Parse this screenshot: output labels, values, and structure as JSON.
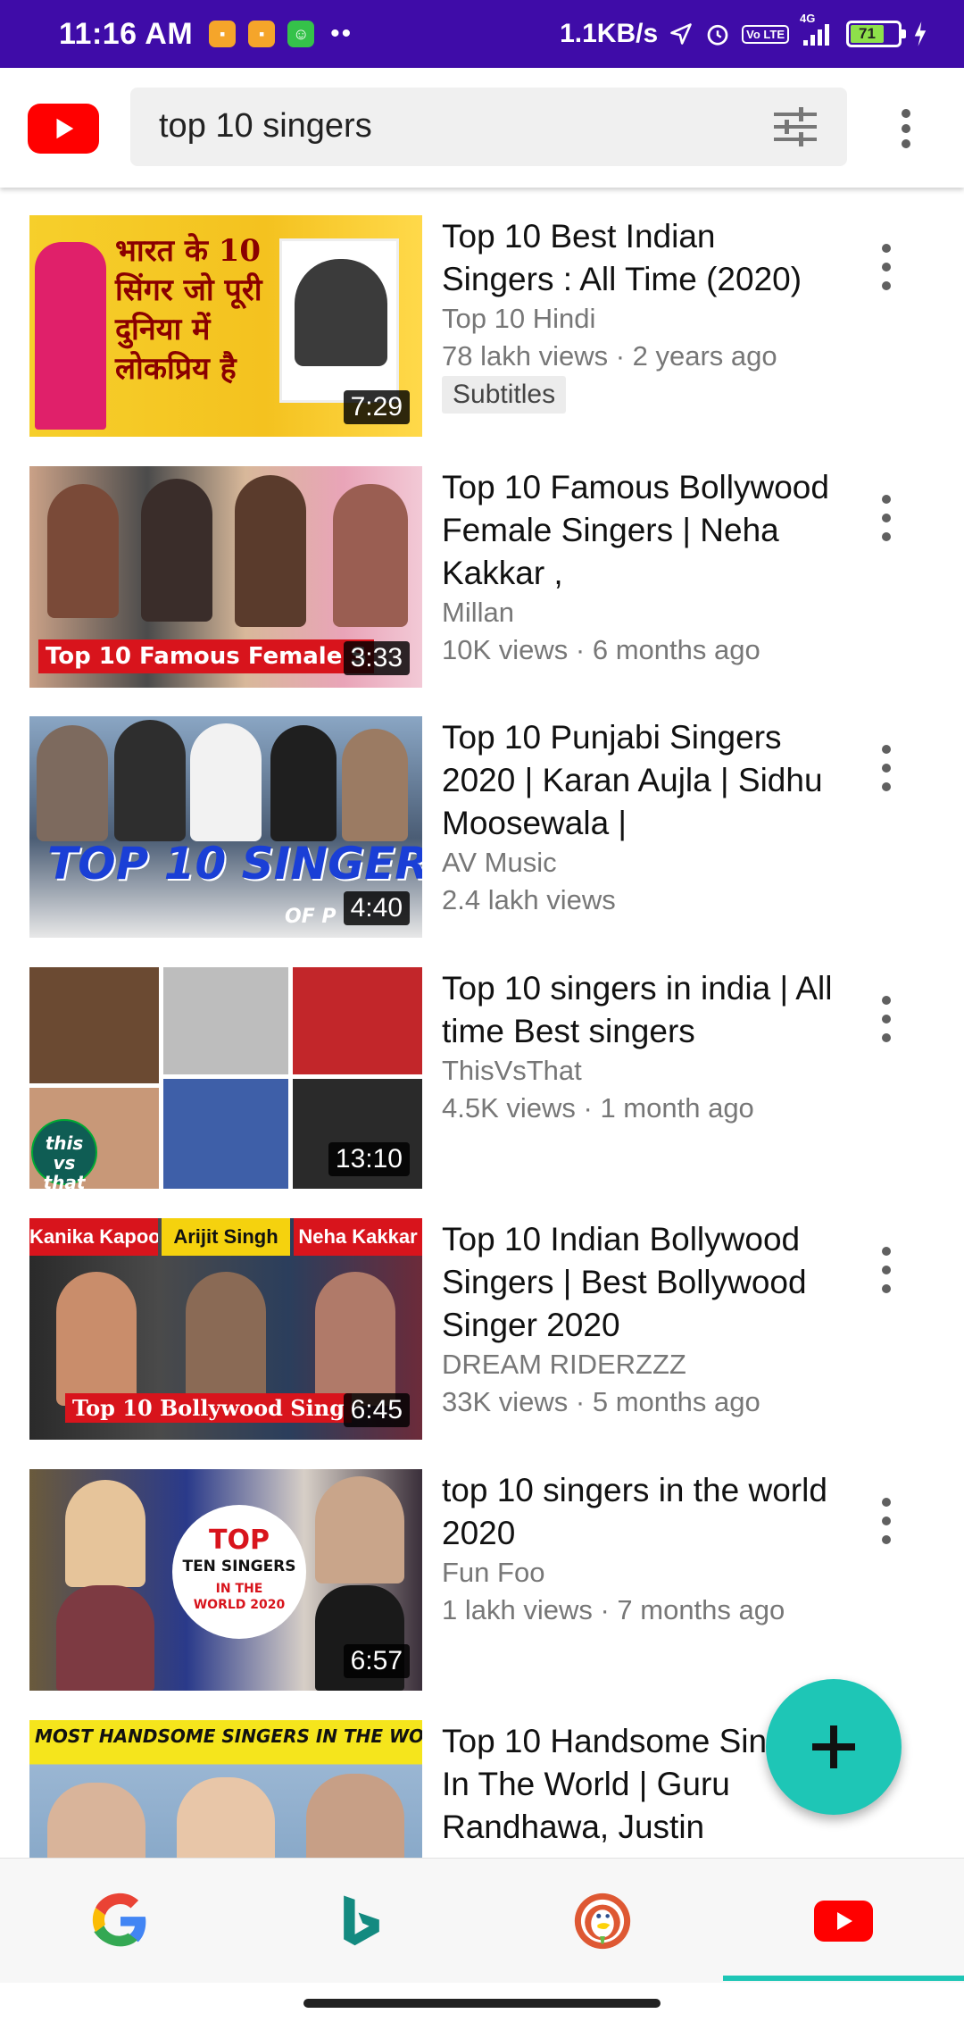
{
  "status_bar": {
    "time": "11:16 AM",
    "notif_dots": "••",
    "net_speed": "1.1KB/s",
    "network": "4G",
    "volte": "Vo LTE",
    "battery": "71"
  },
  "header": {
    "search_query": "top 10 singers",
    "icons": [
      "youtube-logo-icon",
      "filter-sliders-icon",
      "more-vert-icon"
    ]
  },
  "results": [
    {
      "title": "Top 10 Best Indian Singers : All Time (2020)",
      "channel": "Top 10 Hindi",
      "meta": "78 lakh views · 2 years ago",
      "badge": "Subtitles",
      "duration": "7:29",
      "thumb_caption": "भारत के 10 सिंगर जो पूरी दुनिया में लोकप्रिय है",
      "thumb_bg": "#f4c21f"
    },
    {
      "title": "Top 10 Famous Bollywood Female Singers | Neha Kakkar ,",
      "channel": "Millan",
      "meta": "10K views · 6 months ago",
      "badge": "",
      "duration": "3:33",
      "thumb_caption": "Top 10 Famous Female S",
      "thumb_bg": "#b9928a"
    },
    {
      "title": "Top 10 Punjabi Singers 2020 | Karan Aujla | Sidhu Moosewala |",
      "channel": "AV Music",
      "meta": "2.4 lakh views",
      "badge": "",
      "duration": "4:40",
      "thumb_caption": "TOP 10 SINGER",
      "thumb_caption_sub": "OF P",
      "thumb_bg": "#5a6f8c"
    },
    {
      "title": "Top 10 singers in india | All time Best singers",
      "channel": "ThisVsThat",
      "meta": "4.5K views · 1 month ago",
      "badge": "",
      "duration": "13:10",
      "thumb_caption": "this vs that",
      "thumb_bg": "#3a3a3a"
    },
    {
      "title": "Top 10 Indian Bollywood Singers | Best Bollywood Singer 2020",
      "channel": "DREAM RIDERZZZ",
      "meta": "33K views · 5 months ago",
      "badge": "",
      "duration": "6:45",
      "thumb_labels": [
        "Kanika Kapoor",
        "Arijit Singh",
        "Neha Kakkar"
      ],
      "thumb_caption": "Top 10 Bollywood Sing",
      "thumb_bg": "#1c1c1c"
    },
    {
      "title": "top 10 singers in the world 2020",
      "channel": "Fun Foo",
      "meta": "1 lakh views · 7 months ago",
      "badge": "",
      "duration": "6:57",
      "thumb_caption": "TOP",
      "thumb_caption_2": "TEN SINGERS",
      "thumb_caption_3": "IN THE WORLD 2020",
      "thumb_bg": "#5b5b9c"
    },
    {
      "title": "Top 10 Handsome Singer In The World | Guru Randhawa, Justin",
      "channel": "",
      "meta": "",
      "badge": "",
      "duration": "",
      "thumb_caption": "MOST HANDSOME SINGERS IN THE WORLD",
      "thumb_bg": "#6c94b8"
    }
  ],
  "fab": {
    "icon": "plus-icon"
  },
  "bottom_nav": [
    {
      "name": "google",
      "icon": "google-icon"
    },
    {
      "name": "bing",
      "icon": "bing-icon"
    },
    {
      "name": "duckduckgo",
      "icon": "duckduckgo-icon"
    },
    {
      "name": "youtube",
      "icon": "youtube-icon",
      "active": true
    }
  ],
  "colors": {
    "status_bar": "#3f0ca8",
    "youtube_red": "#ff0000",
    "accent_teal": "#1ec6b6"
  }
}
